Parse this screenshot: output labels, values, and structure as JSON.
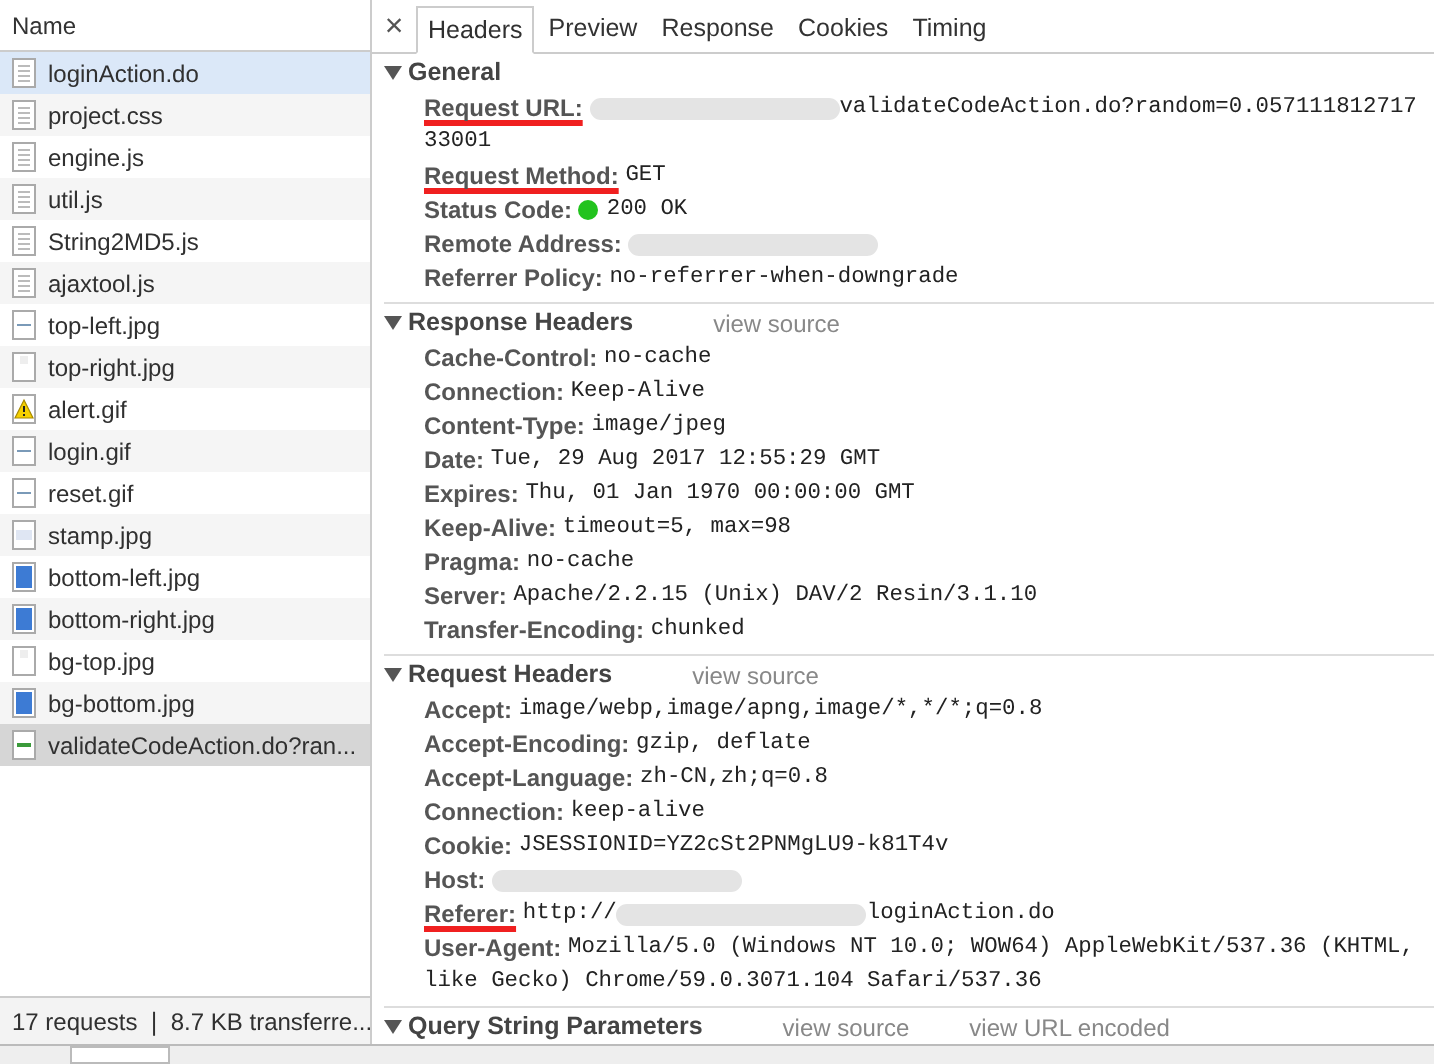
{
  "request_list": {
    "column_header": "Name",
    "files": [
      {
        "name": "loginAction.do",
        "kind": "document",
        "selected": false,
        "hovered": true
      },
      {
        "name": "project.css",
        "kind": "document",
        "selected": false,
        "hovered": false
      },
      {
        "name": "engine.js",
        "kind": "document",
        "selected": false,
        "hovered": false
      },
      {
        "name": "util.js",
        "kind": "document",
        "selected": false,
        "hovered": false
      },
      {
        "name": "String2MD5.js",
        "kind": "document",
        "selected": false,
        "hovered": false
      },
      {
        "name": "ajaxtool.js",
        "kind": "document",
        "selected": false,
        "hovered": false
      },
      {
        "name": "top-left.jpg",
        "kind": "image-line",
        "selected": false,
        "hovered": false
      },
      {
        "name": "top-right.jpg",
        "kind": "image-blank",
        "selected": false,
        "hovered": false
      },
      {
        "name": "alert.gif",
        "kind": "warning",
        "selected": false,
        "hovered": false
      },
      {
        "name": "login.gif",
        "kind": "image-line",
        "selected": false,
        "hovered": false
      },
      {
        "name": "reset.gif",
        "kind": "image-line",
        "selected": false,
        "hovered": false
      },
      {
        "name": "stamp.jpg",
        "kind": "image-light",
        "selected": false,
        "hovered": false
      },
      {
        "name": "bottom-left.jpg",
        "kind": "image-blue",
        "selected": false,
        "hovered": false
      },
      {
        "name": "bottom-right.jpg",
        "kind": "image-blue",
        "selected": false,
        "hovered": false
      },
      {
        "name": "bg-top.jpg",
        "kind": "image-blank",
        "selected": false,
        "hovered": false
      },
      {
        "name": "bg-bottom.jpg",
        "kind": "image-blue",
        "selected": false,
        "hovered": false
      },
      {
        "name": "validateCodeAction.do?ran...",
        "kind": "image-green",
        "selected": true,
        "hovered": false
      }
    ],
    "summary": "17 requests ❘ 8.7 KB transferre..."
  },
  "close_symbol": "×",
  "tabs": [
    {
      "label": "Headers",
      "selected": true
    },
    {
      "label": "Preview",
      "selected": false
    },
    {
      "label": "Response",
      "selected": false
    },
    {
      "label": "Cookies",
      "selected": false
    },
    {
      "label": "Timing",
      "selected": false
    }
  ],
  "sections": [
    {
      "title": "General",
      "expanded": true,
      "rows": [
        {
          "key": "Request URL:",
          "underlined": true,
          "value": [
            {
              "kind": "redacted"
            },
            {
              "kind": "text",
              "text": "validateCodeAction.do?random=0.05711181271733001"
            }
          ]
        },
        {
          "key": "Request Method:",
          "underlined": true,
          "value": [
            {
              "kind": "text",
              "text": "GET"
            }
          ]
        },
        {
          "key": "Status Code:",
          "underlined": false,
          "value": [
            {
              "kind": "status-dot",
              "color": "#22c31e"
            },
            {
              "kind": "text",
              "text": "200 OK"
            }
          ]
        },
        {
          "key": "Remote Address:",
          "underlined": false,
          "value": [
            {
              "kind": "redacted"
            }
          ]
        },
        {
          "key": "Referrer Policy:",
          "underlined": false,
          "value": [
            {
              "kind": "text",
              "text": "no-referrer-when-downgrade"
            }
          ]
        }
      ]
    },
    {
      "title": "Response Headers",
      "expanded": true,
      "links": [
        "view source"
      ],
      "rows": [
        {
          "key": "Cache-Control:",
          "underlined": false,
          "value": [
            {
              "kind": "text",
              "text": "no-cache"
            }
          ]
        },
        {
          "key": "Connection:",
          "underlined": false,
          "value": [
            {
              "kind": "text",
              "text": "Keep-Alive"
            }
          ]
        },
        {
          "key": "Content-Type:",
          "underlined": false,
          "value": [
            {
              "kind": "text",
              "text": "image/jpeg"
            }
          ]
        },
        {
          "key": "Date:",
          "underlined": false,
          "value": [
            {
              "kind": "text",
              "text": "Tue, 29 Aug 2017 12:55:29 GMT"
            }
          ]
        },
        {
          "key": "Expires:",
          "underlined": false,
          "value": [
            {
              "kind": "text",
              "text": "Thu, 01 Jan 1970 00:00:00 GMT"
            }
          ]
        },
        {
          "key": "Keep-Alive:",
          "underlined": false,
          "value": [
            {
              "kind": "text",
              "text": "timeout=5, max=98"
            }
          ]
        },
        {
          "key": "Pragma:",
          "underlined": false,
          "value": [
            {
              "kind": "text",
              "text": "no-cache"
            }
          ]
        },
        {
          "key": "Server:",
          "underlined": false,
          "value": [
            {
              "kind": "text",
              "text": "Apache/2.2.15 (Unix) DAV/2 Resin/3.1.10"
            }
          ]
        },
        {
          "key": "Transfer-Encoding:",
          "underlined": false,
          "value": [
            {
              "kind": "text",
              "text": "chunked"
            }
          ]
        }
      ]
    },
    {
      "title": "Request Headers",
      "expanded": true,
      "links": [
        "view source"
      ],
      "rows": [
        {
          "key": "Accept:",
          "underlined": false,
          "value": [
            {
              "kind": "text",
              "text": "image/webp,image/apng,image/*,*/*;q=0.8"
            }
          ]
        },
        {
          "key": "Accept-Encoding:",
          "underlined": false,
          "value": [
            {
              "kind": "text",
              "text": "gzip, deflate"
            }
          ]
        },
        {
          "key": "Accept-Language:",
          "underlined": false,
          "value": [
            {
              "kind": "text",
              "text": "zh-CN,zh;q=0.8"
            }
          ]
        },
        {
          "key": "Connection:",
          "underlined": false,
          "value": [
            {
              "kind": "text",
              "text": "keep-alive"
            }
          ]
        },
        {
          "key": "Cookie:",
          "underlined": false,
          "value": [
            {
              "kind": "text",
              "text": "JSESSIONID=YZ2cSt2PNMgLU9-k81T4v"
            }
          ]
        },
        {
          "key": "Host:",
          "underlined": false,
          "value": [
            {
              "kind": "redacted"
            }
          ]
        },
        {
          "key": "Referer:",
          "underlined": true,
          "value": [
            {
              "kind": "text",
              "text": "http://"
            },
            {
              "kind": "redacted"
            },
            {
              "kind": "text",
              "text": "loginAction.do"
            }
          ]
        },
        {
          "key": "User-Agent:",
          "underlined": false,
          "value": [
            {
              "kind": "text",
              "text": "Mozilla/5.0 (Windows NT 10.0; WOW64) AppleWebKit/537.36 (KHTML, like Gecko) Chrome/59.0.3071.104 Safari/537.36"
            }
          ]
        }
      ]
    },
    {
      "title": "Query String Parameters",
      "expanded": true,
      "links": [
        "view source",
        "view URL encoded"
      ]
    }
  ]
}
